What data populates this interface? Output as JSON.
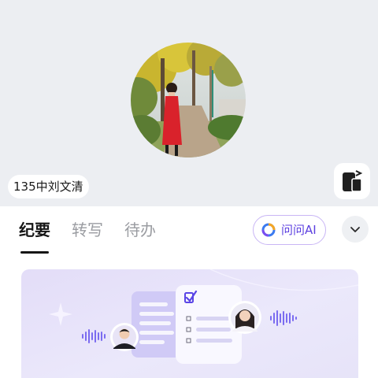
{
  "profile": {
    "name": "135中刘文清",
    "avatar": "photo-avatar",
    "device_icon": "phone-switch-icon"
  },
  "tabs": [
    {
      "label": "纪要",
      "active": true
    },
    {
      "label": "转写",
      "active": false
    },
    {
      "label": "待办",
      "active": false
    }
  ],
  "ai_button": {
    "label": "问问AI",
    "icon": "ai-logo-icon"
  },
  "expand_icon": "chevron-down-icon",
  "colors": {
    "accent": "#5b3fe0",
    "banner_background": "#e9e6fb",
    "top_background": "#eceef2"
  }
}
